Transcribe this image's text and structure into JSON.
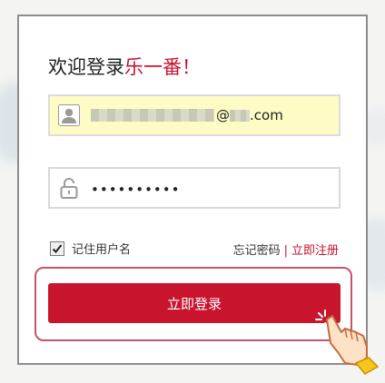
{
  "login": {
    "title_prefix": "欢迎登录",
    "brand_name": "乐一番",
    "title_suffix": "！",
    "username_at": "@",
    "username_domain": "com",
    "password_value": "••••••••••",
    "remember_label": "记住用户名",
    "forgot_password_link": "忘记密码",
    "separator": "|",
    "register_link": "立即注册",
    "submit_label": "立即登录"
  },
  "colors": {
    "accent": "#c8152d",
    "autofill_bg": "#fcfcc4"
  },
  "icons": {
    "user": "user-icon",
    "lock": "lock-icon",
    "check": "check-icon",
    "pointer": "pointing-hand-icon"
  }
}
